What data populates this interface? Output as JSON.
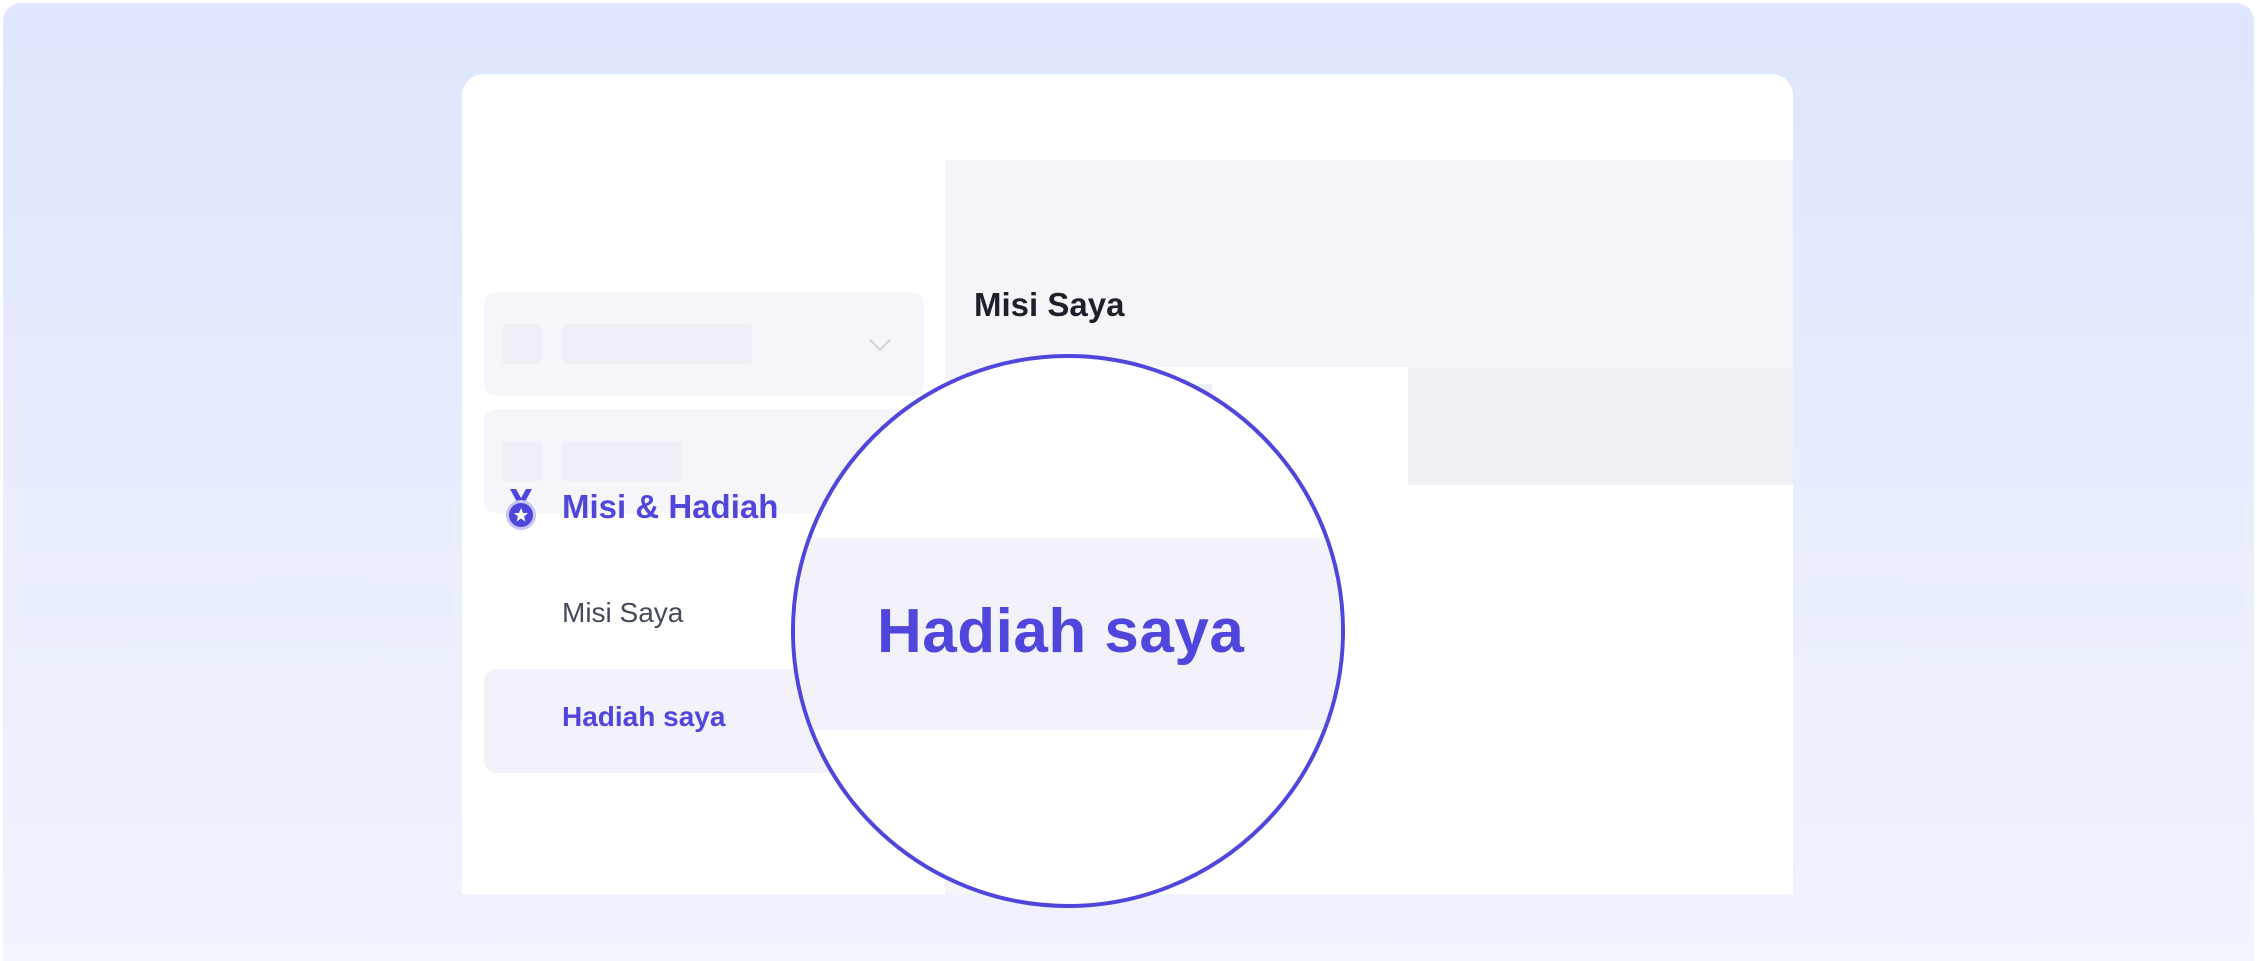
{
  "sidebar": {
    "groups": [
      {
        "state": "collapsed",
        "chevron_icon": "chevron-down-icon"
      },
      {
        "state": "expanded",
        "chevron_icon": "chevron-up-icon"
      }
    ],
    "section": {
      "icon": "medal-icon",
      "label": "Misi & Hadiah",
      "items": [
        {
          "label": "Misi Saya",
          "active": false
        },
        {
          "label": "Hadiah saya",
          "active": true
        }
      ]
    }
  },
  "main": {
    "title": "Misi Saya"
  },
  "magnifier": {
    "label": "Hadiah saya"
  },
  "colors": {
    "accent": "#5046dc",
    "background_top": "#dfe6fd",
    "background_bottom": "#f1f3fd",
    "active_item_bg": "#f3f2fb"
  }
}
